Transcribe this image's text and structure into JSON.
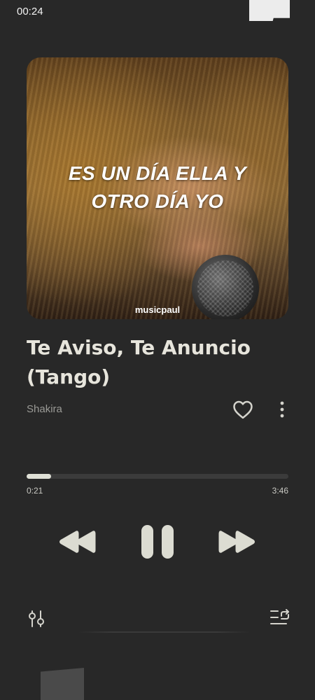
{
  "status_bar": {
    "time": "00:24"
  },
  "artwork": {
    "lyric_line1": "ES UN DÍA ELLA Y",
    "lyric_line2": "OTRO DÍA YO",
    "watermark": "musicpaul"
  },
  "track": {
    "title": "Te Aviso, Te Anuncio (Tango)",
    "artist": "Shakira"
  },
  "playback": {
    "elapsed": "0:21",
    "total": "3:46",
    "progress_fraction": 0.093,
    "state": "playing"
  },
  "icons": {
    "like": "heart-outline-icon",
    "more": "vertical-dots-icon",
    "rewind": "rewind-icon",
    "pause": "pause-icon",
    "forward": "fast-forward-icon",
    "equalizer": "equalizer-sliders-icon",
    "queue": "queue-repeat-icon"
  },
  "colors": {
    "background": "#282828",
    "foreground": "#e7e5dc",
    "secondary_text": "#9a9a96",
    "progress_fill": "#dfe0d6",
    "progress_track": "#3b3b3b"
  }
}
